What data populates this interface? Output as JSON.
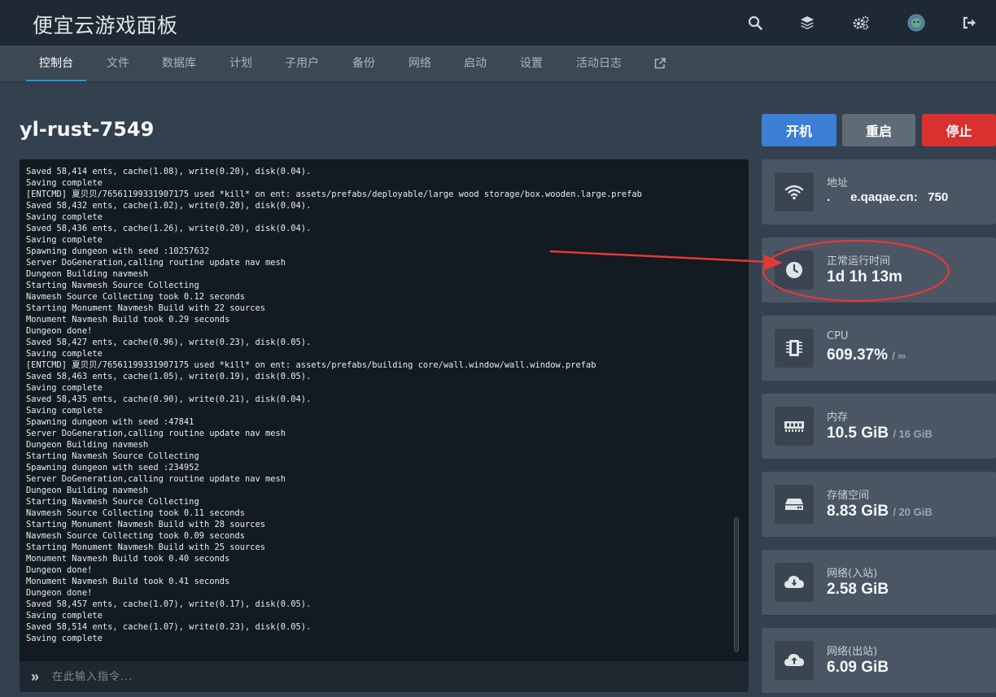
{
  "app": {
    "title": "便宜云游戏面板"
  },
  "top_icons": [
    "search-icon",
    "layers-icon",
    "cogs-icon",
    "user-avatar",
    "logout-icon"
  ],
  "tabs": [
    {
      "label": "控制台",
      "active": true
    },
    {
      "label": "文件"
    },
    {
      "label": "数据库"
    },
    {
      "label": "计划"
    },
    {
      "label": "子用户"
    },
    {
      "label": "备份"
    },
    {
      "label": "网络"
    },
    {
      "label": "启动"
    },
    {
      "label": "设置"
    },
    {
      "label": "活动日志"
    }
  ],
  "server": {
    "name": "yl-rust-7549"
  },
  "power": {
    "start": "开机",
    "restart": "重启",
    "stop": "停止"
  },
  "console": {
    "lines": [
      "Saved 58,414 ents, cache(1.08), write(0.20), disk(0.04).",
      "Saving complete",
      "[ENTCMD] 夏贝贝/76561199331907175 used *kill* on ent: assets/prefabs/deployable/large wood storage/box.wooden.large.prefab",
      "Saved 58,432 ents, cache(1.02), write(0.20), disk(0.04).",
      "Saving complete",
      "Saved 58,436 ents, cache(1.26), write(0.20), disk(0.04).",
      "Saving complete",
      "Spawning dungeon with seed :10257632",
      "Server DoGeneration,calling routine update nav mesh",
      "Dungeon Building navmesh",
      "Starting Navmesh Source Collecting",
      "Navmesh Source Collecting took 0.12 seconds",
      "Starting Monument Navmesh Build with 22 sources",
      "Monument Navmesh Build took 0.29 seconds",
      "Dungeon done!",
      "Saved 58,427 ents, cache(0.96), write(0.23), disk(0.05).",
      "Saving complete",
      "[ENTCMD] 夏贝贝/76561199331907175 used *kill* on ent: assets/prefabs/building core/wall.window/wall.window.prefab",
      "Saved 58,463 ents, cache(1.05), write(0.19), disk(0.05).",
      "Saving complete",
      "Saved 58,435 ents, cache(0.90), write(0.21), disk(0.04).",
      "Saving complete",
      "Spawning dungeon with seed :47841",
      "Server DoGeneration,calling routine update nav mesh",
      "Dungeon Building navmesh",
      "Starting Navmesh Source Collecting",
      "Spawning dungeon with seed :234952",
      "Server DoGeneration,calling routine update nav mesh",
      "Dungeon Building navmesh",
      "Starting Navmesh Source Collecting",
      "Navmesh Source Collecting took 0.11 seconds",
      "Starting Monument Navmesh Build with 28 sources",
      "Navmesh Source Collecting took 0.09 seconds",
      "Starting Monument Navmesh Build with 25 sources",
      "Monument Navmesh Build took 0.40 seconds",
      "Dungeon done!",
      "Monument Navmesh Build took 0.41 seconds",
      "Dungeon done!",
      "Saved 58,457 ents, cache(1.07), write(0.17), disk(0.05).",
      "Saving complete",
      "Saved 58,514 ents, cache(1.07), write(0.23), disk(0.05).",
      "Saving complete"
    ],
    "input_prompt": "»",
    "input_placeholder": "在此输入指令..."
  },
  "stats": {
    "address": {
      "label": "地址",
      "value": ".      e.qaqae.cn:   750",
      "icon": "wifi-icon"
    },
    "uptime": {
      "label": "正常运行时间",
      "value": "1d 1h 13m",
      "icon": "clock-icon"
    },
    "cpu": {
      "label": "CPU",
      "value": "609.37%",
      "limit": "/ ∞",
      "icon": "cpu-chip-icon"
    },
    "memory": {
      "label": "内存",
      "value": "10.5 GiB",
      "limit": "/ 16 GiB",
      "icon": "memory-icon"
    },
    "disk": {
      "label": "存储空间",
      "value": "8.83 GiB",
      "limit": "/ 20 GiB",
      "icon": "hdd-icon"
    },
    "net_in": {
      "label": "网络(入站)",
      "value": "2.58 GiB",
      "icon": "cloud-download-icon"
    },
    "net_out": {
      "label": "网络(出站)",
      "value": "6.09 GiB",
      "icon": "cloud-upload-icon"
    }
  },
  "colors": {
    "accent": "#2b9ad8",
    "start": "#3b7fd6",
    "restart": "#5f6b77",
    "stop": "#d93030",
    "annotation": "#e53935"
  }
}
